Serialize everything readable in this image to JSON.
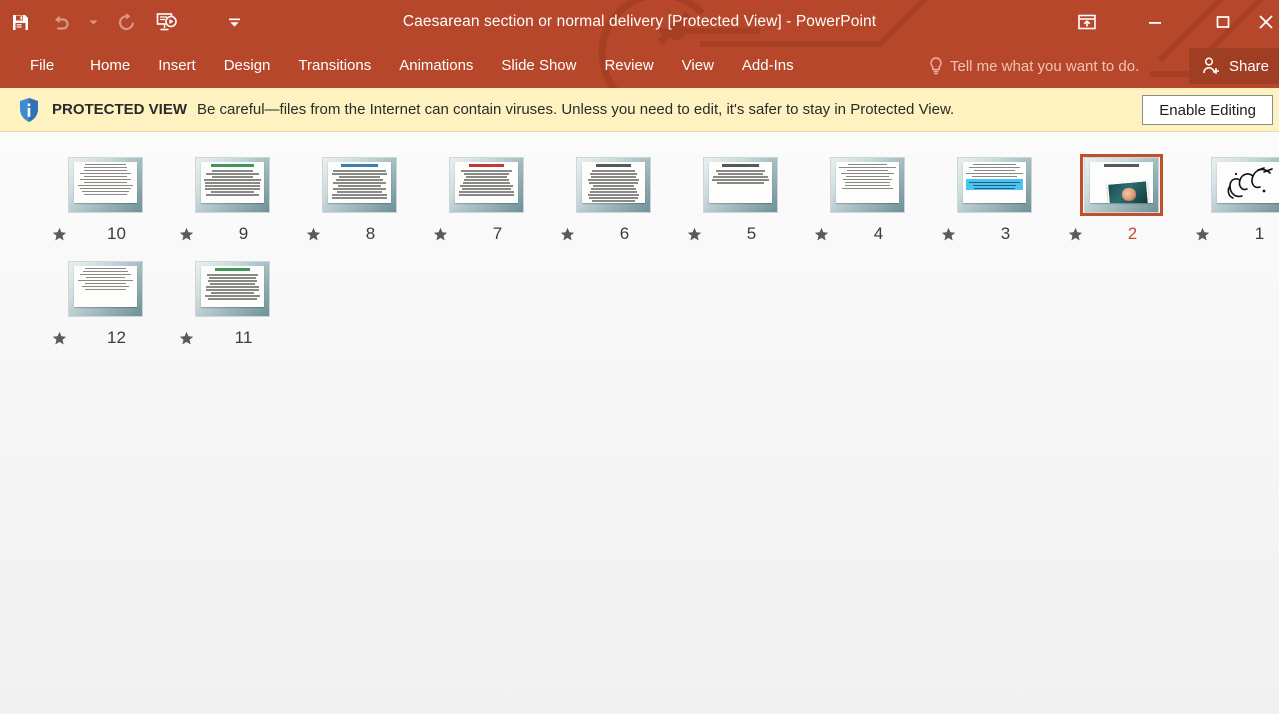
{
  "window": {
    "title": "Caesarean section or normal delivery [Protected View] - PowerPoint",
    "accent_color": "#b7472a",
    "quick_access": [
      {
        "name": "save-button",
        "label": "Save"
      },
      {
        "name": "undo-button",
        "label": "Undo"
      },
      {
        "name": "undo-dropdown",
        "label": "Undo options"
      },
      {
        "name": "redo-button",
        "label": "Redo"
      },
      {
        "name": "start-slideshow-button",
        "label": "Start From Beginning"
      },
      {
        "name": "customize-quick-access-button",
        "label": "Customize Quick Access Toolbar"
      }
    ],
    "controls": [
      {
        "name": "ribbon-display-options-button",
        "label": "Ribbon Display Options"
      },
      {
        "name": "minimize-button",
        "label": "Minimize"
      },
      {
        "name": "restore-button",
        "label": "Restore Down"
      },
      {
        "name": "close-button",
        "label": "Close"
      }
    ]
  },
  "ribbon": {
    "tabs": [
      {
        "label": "File"
      },
      {
        "label": "Home"
      },
      {
        "label": "Insert"
      },
      {
        "label": "Design"
      },
      {
        "label": "Transitions"
      },
      {
        "label": "Animations"
      },
      {
        "label": "Slide Show"
      },
      {
        "label": "Review"
      },
      {
        "label": "View"
      },
      {
        "label": "Add-Ins"
      }
    ],
    "tell_me": "Tell me what you want to do.",
    "share_label": "Share"
  },
  "protected_view": {
    "label": "PROTECTED VIEW",
    "message": "Be careful—files from the Internet can contain viruses. Unless you need to edit, it's safer to stay in Protected View.",
    "button_label": "Enable Editing",
    "background_color": "#fdf2c0"
  },
  "slides": [
    {
      "number": "10",
      "selected": false,
      "style": "text",
      "heading": "none",
      "lines": 11
    },
    {
      "number": "9",
      "selected": false,
      "style": "text",
      "heading": "green",
      "lines": 9
    },
    {
      "number": "8",
      "selected": false,
      "style": "text",
      "heading": "blue",
      "lines": 10
    },
    {
      "number": "7",
      "selected": false,
      "style": "text",
      "heading": "red",
      "lines": 9
    },
    {
      "number": "6",
      "selected": false,
      "style": "text",
      "heading": "dark",
      "lines": 13
    },
    {
      "number": "5",
      "selected": false,
      "style": "text",
      "heading": "dark",
      "lines": 5
    },
    {
      "number": "4",
      "selected": false,
      "style": "text",
      "heading": "none",
      "lines": 9
    },
    {
      "number": "3",
      "selected": false,
      "style": "text-cyan",
      "heading": "none",
      "lines": 8
    },
    {
      "number": "2",
      "selected": true,
      "style": "photo",
      "heading": "dark",
      "lines": 0
    },
    {
      "number": "1",
      "selected": false,
      "style": "calligraphy",
      "heading": "none",
      "lines": 0
    },
    {
      "number": "12",
      "selected": false,
      "style": "text",
      "heading": "none",
      "lines": 8
    },
    {
      "number": "11",
      "selected": false,
      "style": "text",
      "heading": "green",
      "lines": 9
    }
  ],
  "selected_slide_color": "#c0502a"
}
